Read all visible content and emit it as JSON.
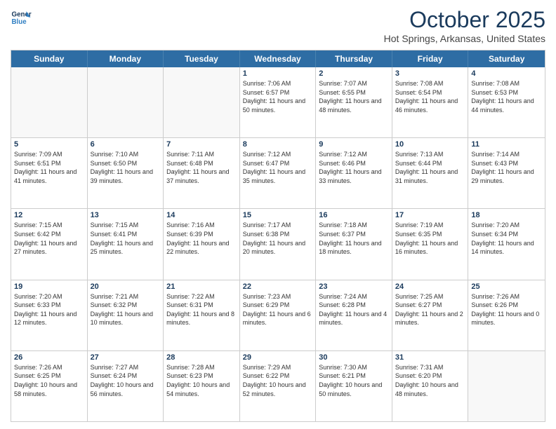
{
  "logo": {
    "line1": "General",
    "line2": "Blue"
  },
  "title": "October 2025",
  "location": "Hot Springs, Arkansas, United States",
  "days_of_week": [
    "Sunday",
    "Monday",
    "Tuesday",
    "Wednesday",
    "Thursday",
    "Friday",
    "Saturday"
  ],
  "weeks": [
    [
      {
        "day": "",
        "info": ""
      },
      {
        "day": "",
        "info": ""
      },
      {
        "day": "",
        "info": ""
      },
      {
        "day": "1",
        "info": "Sunrise: 7:06 AM\nSunset: 6:57 PM\nDaylight: 11 hours and 50 minutes."
      },
      {
        "day": "2",
        "info": "Sunrise: 7:07 AM\nSunset: 6:55 PM\nDaylight: 11 hours and 48 minutes."
      },
      {
        "day": "3",
        "info": "Sunrise: 7:08 AM\nSunset: 6:54 PM\nDaylight: 11 hours and 46 minutes."
      },
      {
        "day": "4",
        "info": "Sunrise: 7:08 AM\nSunset: 6:53 PM\nDaylight: 11 hours and 44 minutes."
      }
    ],
    [
      {
        "day": "5",
        "info": "Sunrise: 7:09 AM\nSunset: 6:51 PM\nDaylight: 11 hours and 41 minutes."
      },
      {
        "day": "6",
        "info": "Sunrise: 7:10 AM\nSunset: 6:50 PM\nDaylight: 11 hours and 39 minutes."
      },
      {
        "day": "7",
        "info": "Sunrise: 7:11 AM\nSunset: 6:48 PM\nDaylight: 11 hours and 37 minutes."
      },
      {
        "day": "8",
        "info": "Sunrise: 7:12 AM\nSunset: 6:47 PM\nDaylight: 11 hours and 35 minutes."
      },
      {
        "day": "9",
        "info": "Sunrise: 7:12 AM\nSunset: 6:46 PM\nDaylight: 11 hours and 33 minutes."
      },
      {
        "day": "10",
        "info": "Sunrise: 7:13 AM\nSunset: 6:44 PM\nDaylight: 11 hours and 31 minutes."
      },
      {
        "day": "11",
        "info": "Sunrise: 7:14 AM\nSunset: 6:43 PM\nDaylight: 11 hours and 29 minutes."
      }
    ],
    [
      {
        "day": "12",
        "info": "Sunrise: 7:15 AM\nSunset: 6:42 PM\nDaylight: 11 hours and 27 minutes."
      },
      {
        "day": "13",
        "info": "Sunrise: 7:15 AM\nSunset: 6:41 PM\nDaylight: 11 hours and 25 minutes."
      },
      {
        "day": "14",
        "info": "Sunrise: 7:16 AM\nSunset: 6:39 PM\nDaylight: 11 hours and 22 minutes."
      },
      {
        "day": "15",
        "info": "Sunrise: 7:17 AM\nSunset: 6:38 PM\nDaylight: 11 hours and 20 minutes."
      },
      {
        "day": "16",
        "info": "Sunrise: 7:18 AM\nSunset: 6:37 PM\nDaylight: 11 hours and 18 minutes."
      },
      {
        "day": "17",
        "info": "Sunrise: 7:19 AM\nSunset: 6:35 PM\nDaylight: 11 hours and 16 minutes."
      },
      {
        "day": "18",
        "info": "Sunrise: 7:20 AM\nSunset: 6:34 PM\nDaylight: 11 hours and 14 minutes."
      }
    ],
    [
      {
        "day": "19",
        "info": "Sunrise: 7:20 AM\nSunset: 6:33 PM\nDaylight: 11 hours and 12 minutes."
      },
      {
        "day": "20",
        "info": "Sunrise: 7:21 AM\nSunset: 6:32 PM\nDaylight: 11 hours and 10 minutes."
      },
      {
        "day": "21",
        "info": "Sunrise: 7:22 AM\nSunset: 6:31 PM\nDaylight: 11 hours and 8 minutes."
      },
      {
        "day": "22",
        "info": "Sunrise: 7:23 AM\nSunset: 6:29 PM\nDaylight: 11 hours and 6 minutes."
      },
      {
        "day": "23",
        "info": "Sunrise: 7:24 AM\nSunset: 6:28 PM\nDaylight: 11 hours and 4 minutes."
      },
      {
        "day": "24",
        "info": "Sunrise: 7:25 AM\nSunset: 6:27 PM\nDaylight: 11 hours and 2 minutes."
      },
      {
        "day": "25",
        "info": "Sunrise: 7:26 AM\nSunset: 6:26 PM\nDaylight: 11 hours and 0 minutes."
      }
    ],
    [
      {
        "day": "26",
        "info": "Sunrise: 7:26 AM\nSunset: 6:25 PM\nDaylight: 10 hours and 58 minutes."
      },
      {
        "day": "27",
        "info": "Sunrise: 7:27 AM\nSunset: 6:24 PM\nDaylight: 10 hours and 56 minutes."
      },
      {
        "day": "28",
        "info": "Sunrise: 7:28 AM\nSunset: 6:23 PM\nDaylight: 10 hours and 54 minutes."
      },
      {
        "day": "29",
        "info": "Sunrise: 7:29 AM\nSunset: 6:22 PM\nDaylight: 10 hours and 52 minutes."
      },
      {
        "day": "30",
        "info": "Sunrise: 7:30 AM\nSunset: 6:21 PM\nDaylight: 10 hours and 50 minutes."
      },
      {
        "day": "31",
        "info": "Sunrise: 7:31 AM\nSunset: 6:20 PM\nDaylight: 10 hours and 48 minutes."
      },
      {
        "day": "",
        "info": ""
      }
    ]
  ]
}
